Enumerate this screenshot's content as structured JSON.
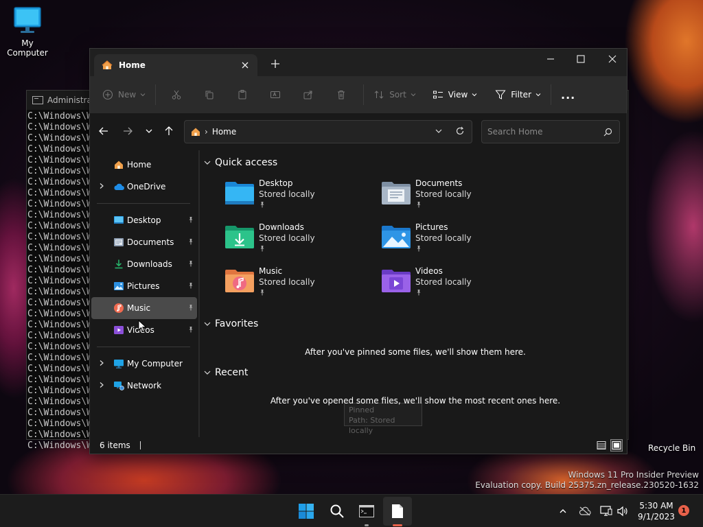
{
  "desktop": {
    "my_computer_label": "My Computer",
    "recycle_bin_label": "Recycle Bin",
    "watermark_line1": "Windows 11 Pro Insider Preview",
    "watermark_line2": "Evaluation copy. Build 25375.zn_release.230520-1632"
  },
  "terminal": {
    "title": "Administrat",
    "line_text": "C:\\Windows\\Wi",
    "line_count": 31
  },
  "explorer": {
    "tab_title": "Home",
    "commands": {
      "new": "New",
      "sort": "Sort",
      "view": "View",
      "filter": "Filter",
      "more": "..."
    },
    "address": {
      "crumb": "Home"
    },
    "search": {
      "placeholder": "Search Home"
    },
    "nav": {
      "home": "Home",
      "onedrive": "OneDrive",
      "pinned": [
        {
          "label": "Desktop",
          "icon": "desktop-folder-icon"
        },
        {
          "label": "Documents",
          "icon": "documents-folder-icon"
        },
        {
          "label": "Downloads",
          "icon": "downloads-folder-icon"
        },
        {
          "label": "Pictures",
          "icon": "pictures-folder-icon"
        },
        {
          "label": "Music",
          "icon": "music-folder-icon"
        },
        {
          "label": "Videos",
          "icon": "videos-folder-icon"
        }
      ],
      "my_computer": "My Computer",
      "network": "Network"
    },
    "quick_access": {
      "header": "Quick access",
      "items": [
        {
          "name": "Desktop",
          "sub": "Stored locally"
        },
        {
          "name": "Documents",
          "sub": "Stored locally"
        },
        {
          "name": "Downloads",
          "sub": "Stored locally"
        },
        {
          "name": "Pictures",
          "sub": "Stored locally"
        },
        {
          "name": "Music",
          "sub": "Stored locally"
        },
        {
          "name": "Videos",
          "sub": "Stored locally"
        }
      ]
    },
    "tooltip": {
      "line1": "Pinned",
      "line2": "Path: Stored locally"
    },
    "favorites": {
      "header": "Favorites",
      "empty": "After you've pinned some files, we'll show them here."
    },
    "recent": {
      "header": "Recent",
      "empty": "After you've opened some files, we'll show the most recent ones here."
    },
    "status": {
      "items_count": "6 items"
    }
  },
  "taskbar": {
    "time": "5:30 AM",
    "date": "9/1/2023",
    "notification_count": "1"
  },
  "colors": {
    "accent": "#0078d4",
    "folder_yellow": "#f4c542",
    "onedrive_blue": "#1e8ce6",
    "notification": "#e8614a"
  }
}
